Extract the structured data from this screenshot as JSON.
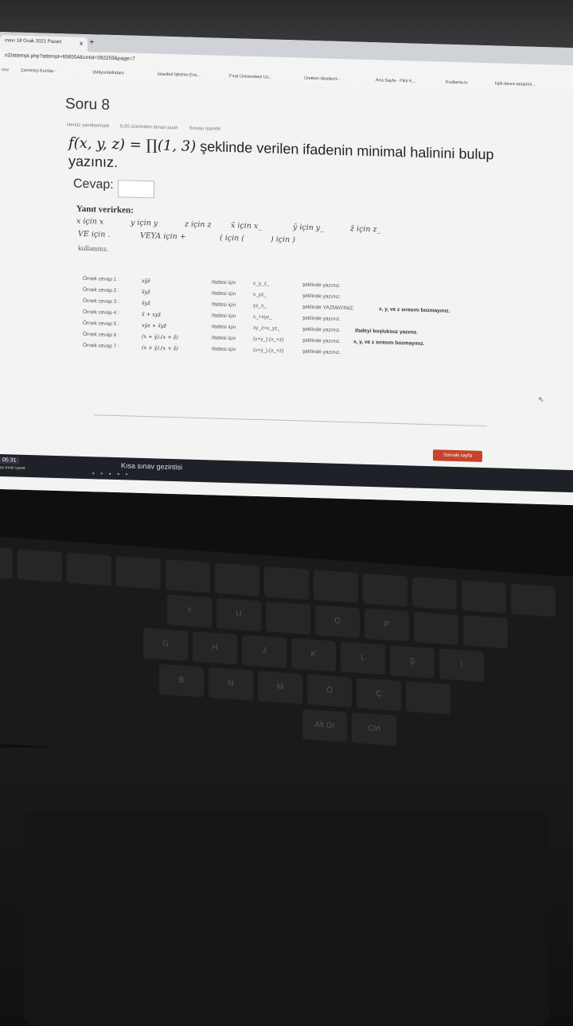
{
  "browser": {
    "tab_title": "ınavı 18 Ocak 2021 Pazart",
    "tab_close": "x",
    "new_tab": "+",
    "address": "o2/attempt.php?attempt=656554&cmid=392259&page=7",
    "bookmarks": [
      "ıvıır",
      "Çevrimiçi Kurslar -",
      "1Milyonİstihdam",
      "İstanbul İşletme Ens...",
      "Fırat Üniversitesi Uz...",
      "Üretken Akademi -",
      "Ana Sayfa - Fikir K...",
      "Kodlama.io",
      "lojik-devre-tasarimi..."
    ]
  },
  "quiz": {
    "title": "Soru 8",
    "status": "Henüz yanıtlanmadı",
    "points": "5,00 üzerinden alınan puan",
    "flag": "Soruyu işaretle",
    "question_math": "f(x, y, z) = ∏(1, 3)",
    "question_text": "şeklinde verilen ifadenin minimal halinini bulup yazınız.",
    "answer_label": "Cevap:",
    "instructions_title": "Yanıt verirken:",
    "rules_row1": [
      "x için x",
      "y için y",
      "z için z",
      "x̄ için x_",
      "ȳ için y_",
      "z̄ için z_"
    ],
    "rules_row2": [
      "VE için .",
      "VEYA için +",
      "( için (",
      ") için )"
    ],
    "use_text": "kullanınız.",
    "examples": [
      {
        "label": "Örnek cevap 1 :",
        "expr": "xȳz̄",
        "ifade": "ifadesi için",
        "ans": "x_y_z_",
        "note": "şeklinde yazınız.",
        "bold": ""
      },
      {
        "label": "Örnek cevap 2 :",
        "expr": "x̄yz̄",
        "ifade": "ifadesi için",
        "ans": "x_yz_",
        "note": "şeklinde yazınız.",
        "bold": ""
      },
      {
        "label": "Örnek cevap 3 :",
        "expr": "x̄yz̄",
        "ifade": "ifadesi için",
        "ans": "yz_x_",
        "note": "şeklinde YAZMAYINIZ.",
        "bold": "x, y, ve z sırasını bozmayınız."
      },
      {
        "label": "Örnek cevap 4 :",
        "expr": "x̄ + xyz̄",
        "ifade": "ifadesi için",
        "ans": "x_+xyz_",
        "note": "şeklinde yazınız.",
        "bold": ""
      },
      {
        "label": "Örnek cevap 5 :",
        "expr": "xȳz + x̄yz̄",
        "ifade": "ifadesi için",
        "ans": "xy_z+x_yz_",
        "note": "şeklinde yazınız.",
        "bold": "ifadeyi boşluksuz yazınız."
      },
      {
        "label": "Örnek cevap 6 :",
        "expr": "(x + ȳ).(x + z̄)",
        "ifade": "ifadesi için",
        "ans": "(x+y_).(x_+z)",
        "note": "şeklinde yazınız.",
        "bold": "x, y, ve z sırasını bozmayınız."
      },
      {
        "label": "Örnek cevap 7 :",
        "expr": "(x + ȳ).(x + z̄)",
        "ifade": "ifadesi için",
        "ans": "(x+y_).(x_+z)",
        "note": "şeklinde yazınız.",
        "bold": ""
      }
    ],
    "next_button": "Sonraki sayfa",
    "nav_link": "Kısa sınav gezintisi"
  },
  "taskbar": {
    "time": "05:31",
    "sub": "şu bırak işaret"
  },
  "keyboard": {
    "row1": [
      "",
      "",
      "",
      "",
      "",
      "",
      "",
      "",
      "",
      "",
      "",
      ""
    ],
    "row2": [
      "Y",
      "U",
      "",
      "O",
      "P",
      "",
      ""
    ],
    "row3": [
      "G",
      "H",
      "J",
      "K",
      "L",
      "Ş",
      "İ"
    ],
    "row4": [
      "B",
      "N",
      "M",
      "Ö",
      "Ç",
      ""
    ],
    "row5": [
      "Alt Gr",
      "Ctrl"
    ]
  }
}
